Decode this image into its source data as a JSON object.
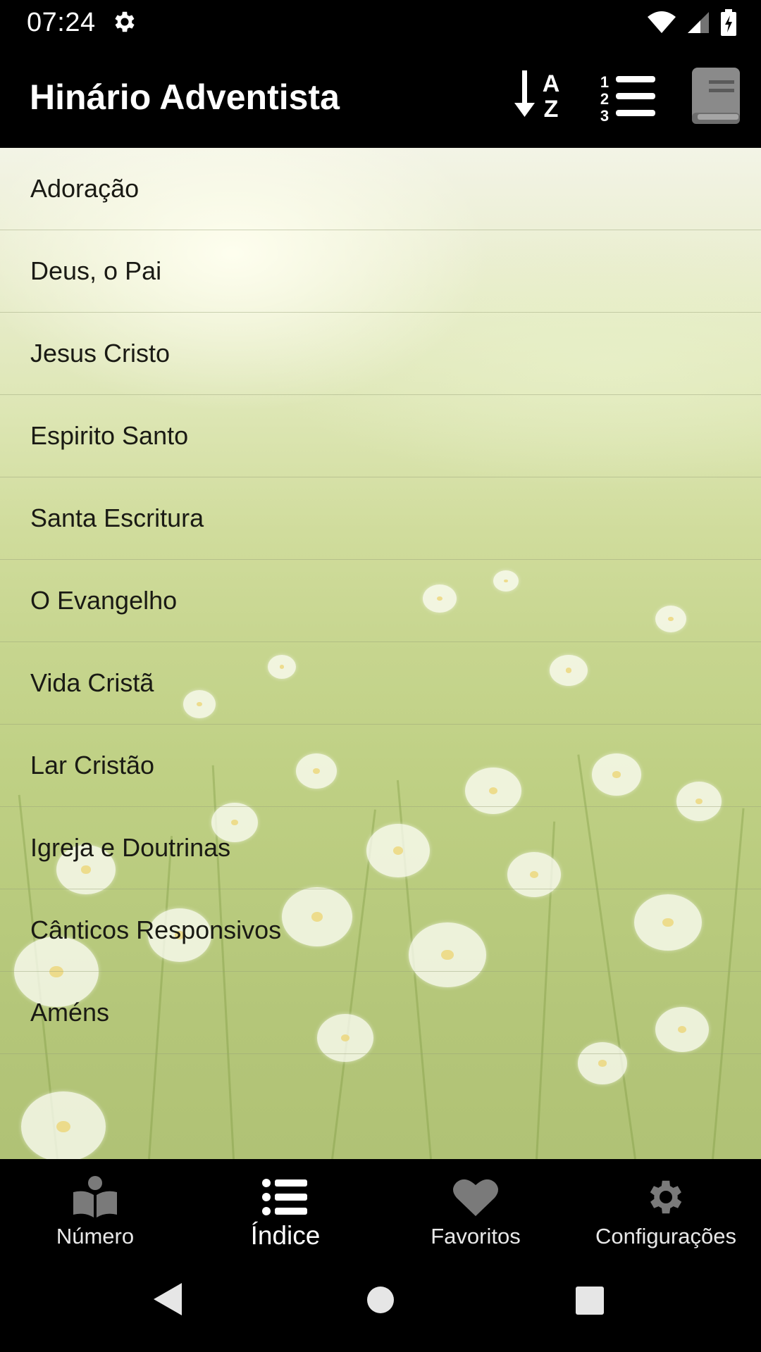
{
  "status_bar": {
    "time": "07:24"
  },
  "app_bar": {
    "title": "Hinário Adventista",
    "actions": [
      "sort-alpha-icon",
      "numbered-list-icon",
      "book-icon"
    ]
  },
  "categories": [
    "Adoração",
    "Deus, o Pai",
    "Jesus Cristo",
    "Espirito Santo",
    "Santa Escritura",
    "O Evangelho",
    "Vida Cristã",
    "Lar Cristão",
    "Igreja e Doutrinas",
    "Cânticos Responsivos",
    "Améns"
  ],
  "bottom_nav": {
    "items": [
      {
        "label": "Número",
        "icon": "open-book-icon"
      },
      {
        "label": "Índice",
        "icon": "list-icon",
        "active": true
      },
      {
        "label": "Favoritos",
        "icon": "heart-icon"
      },
      {
        "label": "Configurações",
        "icon": "gear-icon"
      }
    ]
  },
  "colors": {
    "bar_background": "#000000",
    "nav_icon_inactive": "#7a7a7a",
    "nav_icon_active": "#ffffff",
    "list_text": "#1a1a14"
  }
}
